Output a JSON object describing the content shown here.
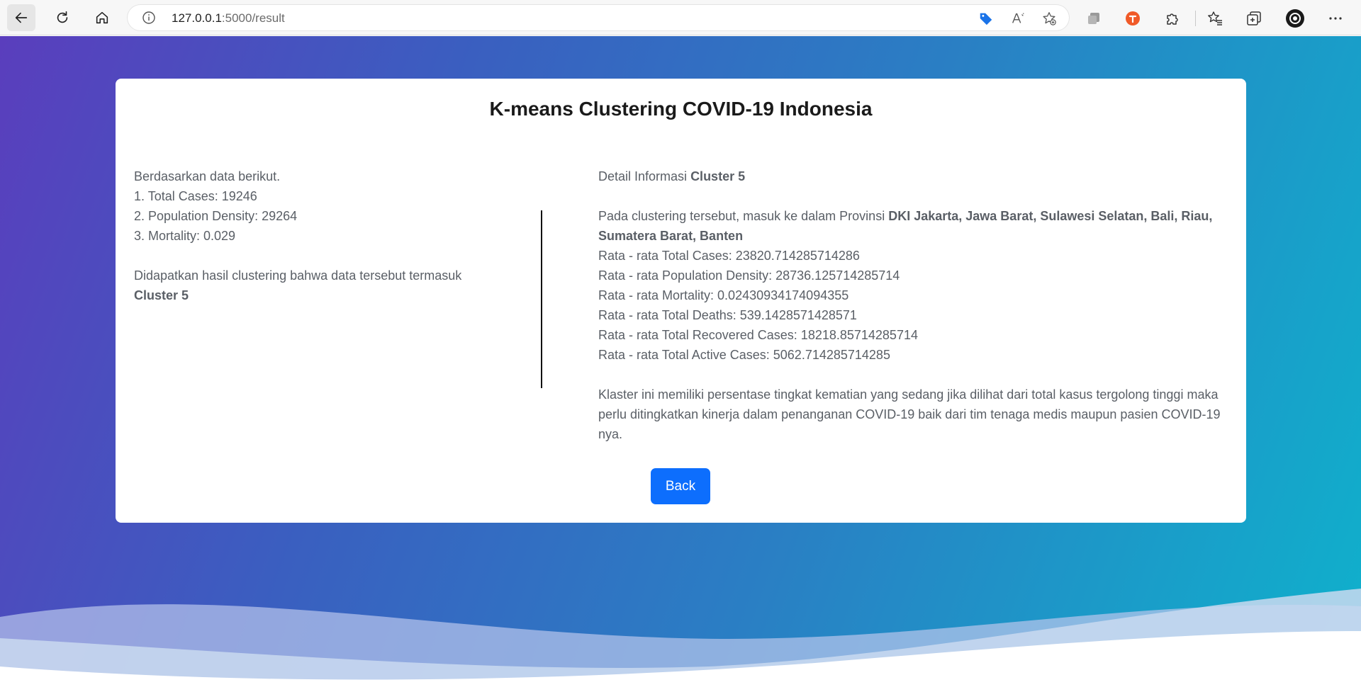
{
  "browser": {
    "url_host": "127.0.0.1",
    "url_path": ":5000/result"
  },
  "card": {
    "title": "K-means Clustering COVID-19 Indonesia",
    "input": {
      "intro": "Berdasarkan data berikut.",
      "items": [
        "1. Total Cases: 19246",
        "2. Population Density: 29264",
        "3. Mortality: 0.029"
      ],
      "result_text": "Didapatkan hasil clustering bahwa data tersebut termasuk",
      "result_cluster": "Cluster 5"
    },
    "detail": {
      "heading_prefix": "Detail Informasi",
      "heading_cluster": "Cluster 5",
      "provinces_prefix": "Pada clustering tersebut, masuk ke dalam Provinsi",
      "provinces": "DKI Jakarta, Jawa Barat, Sulawesi Selatan, Bali, Riau, Sumatera Barat, Banten",
      "stats": [
        "Rata - rata Total Cases: 23820.714285714286",
        "Rata - rata Population Density: 28736.125714285714",
        "Rata - rata Mortality: 0.02430934174094355",
        "Rata - rata Total Deaths: 539.1428571428571",
        "Rata - rata Total Recovered Cases: 18218.85714285714",
        "Rata - rata Total Active Cases: 5062.714285714285"
      ],
      "conclusion": "Klaster ini memiliki persentase tingkat kematian yang sedang jika dilihat dari total kasus tergolong tinggi maka perlu ditingkatkan kinerja dalam penanganan COVID-19 baik dari tim tenaga medis maupun pasien COVID-19 nya."
    },
    "back_label": "Back"
  },
  "colors": {
    "primary_button": "#0d6efd",
    "gradient_start": "#5a3ebd",
    "gradient_end": "#0fb1cc"
  }
}
